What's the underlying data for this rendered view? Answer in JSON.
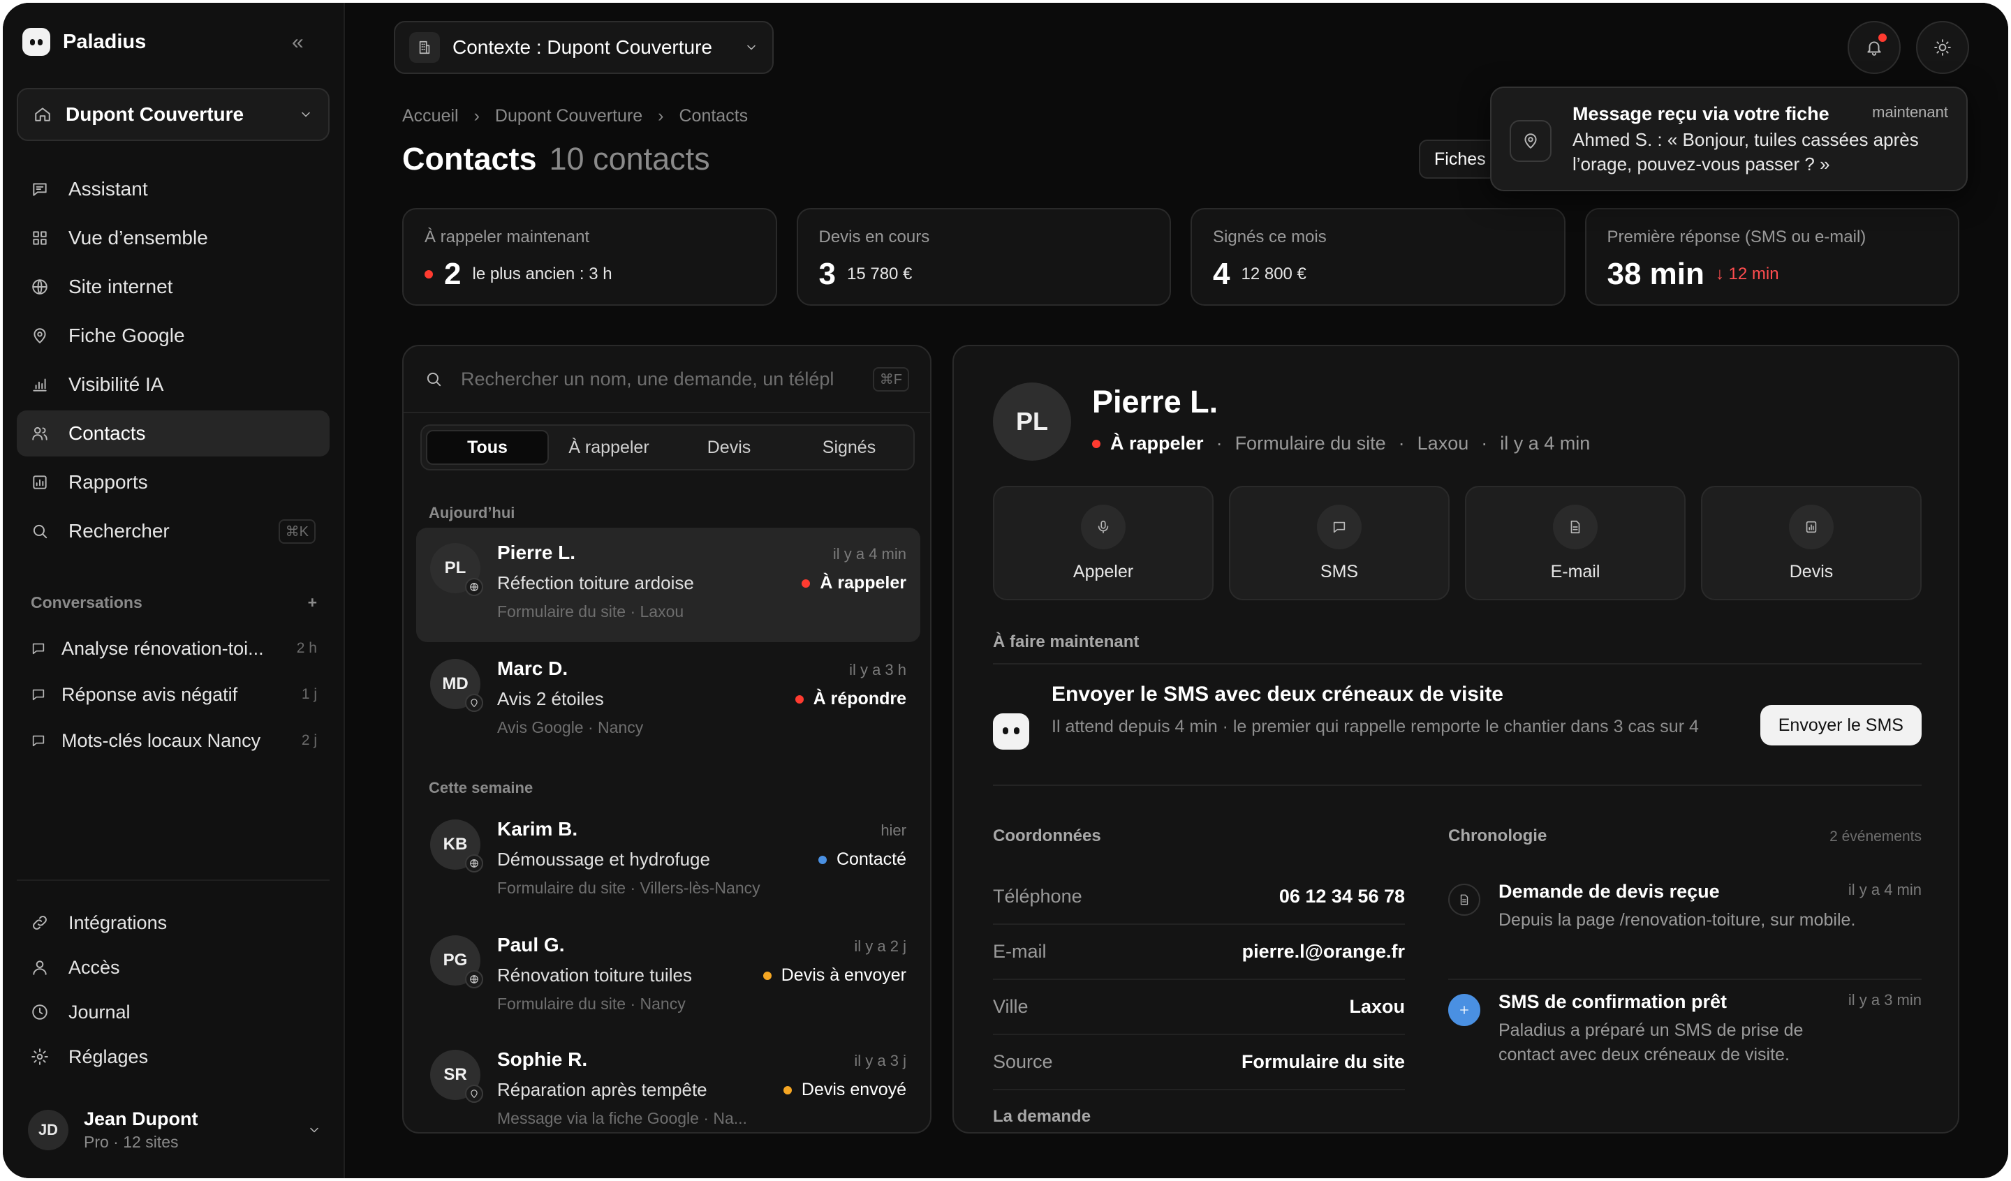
{
  "app": {
    "name": "Paladius"
  },
  "site_select": {
    "label": "Dupont Couverture"
  },
  "nav": [
    {
      "label": "Assistant",
      "icon": "chat-icon"
    },
    {
      "label": "Vue d’ensemble",
      "icon": "grid-icon"
    },
    {
      "label": "Site internet",
      "icon": "globe-icon"
    },
    {
      "label": "Fiche Google",
      "icon": "map-pin-icon"
    },
    {
      "label": "Visibilité IA",
      "icon": "bar-chart-icon"
    },
    {
      "label": "Contacts",
      "icon": "users-icon",
      "active": true
    },
    {
      "label": "Rapports",
      "icon": "report-icon"
    },
    {
      "label": "Rechercher",
      "icon": "search-icon",
      "shortcut": "⌘K"
    }
  ],
  "conversations": {
    "header": "Conversations",
    "items": [
      {
        "title": "Analyse rénovation-toi...",
        "time": "2 h"
      },
      {
        "title": "Réponse avis négatif",
        "time": "1 j"
      },
      {
        "title": "Mots-clés locaux Nancy",
        "time": "2 j"
      }
    ]
  },
  "bottom_nav": [
    {
      "label": "Intégrations",
      "icon": "link-icon"
    },
    {
      "label": "Accès",
      "icon": "user-icon"
    },
    {
      "label": "Journal",
      "icon": "clock-icon"
    },
    {
      "label": "Réglages",
      "icon": "gear-icon"
    }
  ],
  "user": {
    "initials": "JD",
    "name": "Jean Dupont",
    "sub": "Pro · 12 sites"
  },
  "context": {
    "label": "Contexte : Dupont Couverture"
  },
  "breadcrumb": [
    "Accueil",
    "›",
    "Dupont Couverture",
    "›",
    "Contacts"
  ],
  "page": {
    "title": "Contacts",
    "count": "10 contacts"
  },
  "fiches_button": "Fiches",
  "toast": {
    "title": "Message reçu via votre fiche",
    "time": "maintenant",
    "body": "Ahmed S. : « Bonjour, tuiles cassées après l’orage, pouvez-vous passer ? »"
  },
  "stats": [
    {
      "label": "À rappeler maintenant",
      "value": "2",
      "sub": "le plus ancien : 3 h",
      "dot": "red"
    },
    {
      "label": "Devis en cours",
      "value": "3",
      "sub": "15 780 €"
    },
    {
      "label": "Signés ce mois",
      "value": "4",
      "sub": "12 800 €"
    },
    {
      "label": "Première réponse (SMS ou e-mail)",
      "value": "38 min",
      "delta": "↓ 12 min"
    }
  ],
  "search": {
    "placeholder": "Rechercher un nom, une demande, un télépl",
    "shortcut": "⌘F"
  },
  "filters": [
    {
      "label": "Tous",
      "active": true
    },
    {
      "label": "À rappeler"
    },
    {
      "label": "Devis"
    },
    {
      "label": "Signés"
    }
  ],
  "groups": {
    "today": "Aujourd’hui",
    "week": "Cette semaine"
  },
  "contacts": [
    {
      "initials": "PL",
      "name": "Pierre L.",
      "time": "il y a 4 min",
      "demand": "Réfection toiture ardoise",
      "status": "À rappeler",
      "dot": "red",
      "bold": true,
      "source": "Formulaire du site · Laxou",
      "src_icon": "globe-icon",
      "active": true
    },
    {
      "initials": "MD",
      "name": "Marc D.",
      "time": "il y a 3 h",
      "demand": "Avis 2 étoiles",
      "status": "À répondre",
      "dot": "red",
      "bold": true,
      "source": "Avis Google · Nancy",
      "src_icon": "map-pin-icon"
    },
    {
      "initials": "KB",
      "name": "Karim B.",
      "time": "hier",
      "demand": "Démoussage et hydrofuge",
      "status": "Contacté",
      "dot": "blue",
      "source": "Formulaire du site · Villers-lès-Nancy",
      "src_icon": "globe-icon"
    },
    {
      "initials": "PG",
      "name": "Paul G.",
      "time": "il y a 2 j",
      "demand": "Rénovation toiture tuiles",
      "status": "Devis à envoyer",
      "dot": "amber",
      "source": "Formulaire du site · Nancy",
      "src_icon": "globe-icon"
    },
    {
      "initials": "SR",
      "name": "Sophie R.",
      "time": "il y a 3 j",
      "demand": "Réparation après tempête",
      "status": "Devis envoyé",
      "dot": "amber",
      "source": "Message via la fiche Google · Na...",
      "src_icon": "map-pin-icon"
    }
  ],
  "detail": {
    "initials": "PL",
    "name": "Pierre L.",
    "status": "À rappeler",
    "meta": [
      "Formulaire du site",
      "Laxou",
      "il y a 4 min"
    ],
    "sep": "·",
    "actions": [
      {
        "label": "Appeler",
        "icon": "microphone-icon"
      },
      {
        "label": "SMS",
        "icon": "message-icon"
      },
      {
        "label": "E-mail",
        "icon": "document-icon"
      },
      {
        "label": "Devis",
        "icon": "chart-doc-icon"
      }
    ],
    "todo_header": "À faire maintenant",
    "todo": {
      "title": "Envoyer le SMS avec deux créneaux de visite",
      "desc": "Il attend depuis 4 min · le premier qui rappelle remporte le chantier dans 3 cas sur 4",
      "button": "Envoyer le SMS"
    },
    "coords_header": "Coordonnées",
    "coords": [
      {
        "key": "Téléphone",
        "value": "06 12 34 56 78"
      },
      {
        "key": "E-mail",
        "value": "pierre.l@orange.fr"
      },
      {
        "key": "Ville",
        "value": "Laxou"
      },
      {
        "key": "Source",
        "value": "Formulaire du site"
      }
    ],
    "chrono_header": "Chronologie",
    "chrono_count": "2 événements",
    "events": [
      {
        "title": "Demande de devis reçue",
        "time": "il y a 4 min",
        "desc": "Depuis la page /renovation-toiture, sur mobile."
      },
      {
        "title": "SMS de confirmation prêt",
        "time": "il y a 3 min",
        "desc": "Paladius a préparé un SMS de prise de contact avec deux créneaux de visite."
      }
    ],
    "demand_header": "La demande"
  }
}
